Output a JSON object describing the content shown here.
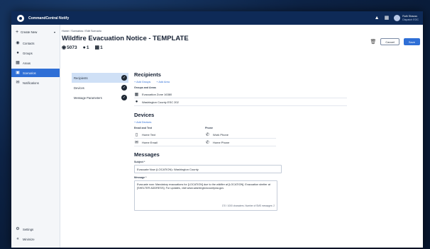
{
  "app": {
    "name": "CommandCentral Notify"
  },
  "header": {
    "bell_icon": "bell-icon",
    "grid_icon": "grid-icon",
    "user": {
      "name": "Ruth Strauss",
      "org": "Dispatch EOC"
    }
  },
  "sidebar": {
    "create_new": "Create New",
    "items": [
      {
        "label": "Contacts",
        "icon": "contacts-icon"
      },
      {
        "label": "Groups",
        "icon": "groups-icon"
      },
      {
        "label": "Areas",
        "icon": "areas-icon"
      },
      {
        "label": "Scenarios",
        "icon": "scenarios-icon",
        "active": true
      },
      {
        "label": "Notifications",
        "icon": "notifications-icon"
      }
    ],
    "bottom": [
      {
        "label": "Settings",
        "icon": "gear-icon"
      },
      {
        "label": "Minimize",
        "icon": "collapse-icon"
      }
    ]
  },
  "breadcrumb": "Home / Scenarios / Edit Scenario",
  "page_title": "Wildfire Evacuation Notice - TEMPLATE",
  "stats": {
    "contacts": "5073",
    "groups": "1",
    "areas": "1"
  },
  "toolbar": {
    "cancel": "Cancel",
    "save": "Save"
  },
  "tabs": [
    "Recipients",
    "Devices",
    "Message Parameters"
  ],
  "recipients": {
    "title": "Recipients",
    "add_groups": "+ Add Groups",
    "add_area": "+ Add Area",
    "groups_label": "Groups and Areas",
    "items": [
      "Evacuation Zone 16380",
      "Washington County ESC 202"
    ]
  },
  "devices": {
    "title": "Devices",
    "add_devices": "+ Add Devices",
    "email_label": "Email and Text",
    "phone_label": "Phone",
    "email_items": [
      "Home Text",
      "Home Email"
    ],
    "phone_items": [
      "Work Phone",
      "Home Phone"
    ]
  },
  "messages": {
    "title": "Messages",
    "subject_label": "Subject *",
    "subject_value": "Evacuate Now (LOCATION): Washington County",
    "message_label": "Message *",
    "message_value": "Evacuate now: Mandatory evacuations for [LOCATION] due to the wildfire at [LOCATION]. Evacuation shelter at [SHELTER ADDRESS]. For updates, visit www.washingtoncountywa.gov.",
    "counter": "170 / 1000 characters. Number of SMS messages: 2"
  }
}
